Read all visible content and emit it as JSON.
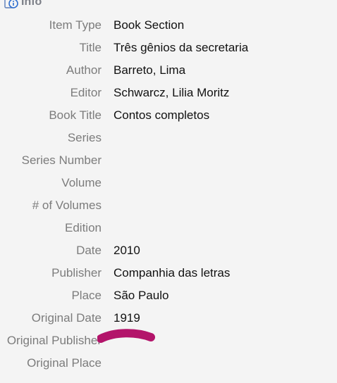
{
  "section": {
    "title": "Info",
    "icon": "info-icon"
  },
  "fields": [
    {
      "label": "Item Type",
      "value": "Book Section"
    },
    {
      "label": "Title",
      "value": "Três gênios da secretaria"
    },
    {
      "label": "Author",
      "value": "Barreto, Lima"
    },
    {
      "label": "Editor",
      "value": "Schwarcz, Lilia Moritz"
    },
    {
      "label": "Book Title",
      "value": "Contos completos"
    },
    {
      "label": "Series",
      "value": ""
    },
    {
      "label": "Series Number",
      "value": ""
    },
    {
      "label": "Volume",
      "value": ""
    },
    {
      "label": "# of Volumes",
      "value": ""
    },
    {
      "label": "Edition",
      "value": ""
    },
    {
      "label": "Date",
      "value": "2010"
    },
    {
      "label": "Publisher",
      "value": "Companhia das letras"
    },
    {
      "label": "Place",
      "value": "São Paulo"
    },
    {
      "label": "Original Date",
      "value": "1919"
    },
    {
      "label": "Original Publisher",
      "value": ""
    },
    {
      "label": "Original Place",
      "value": ""
    }
  ],
  "colors": {
    "background": "#f4f4f4",
    "label": "#7c7c7c",
    "value": "#111111",
    "icon": "#2f6fd0",
    "annotation": "#b3146a"
  }
}
